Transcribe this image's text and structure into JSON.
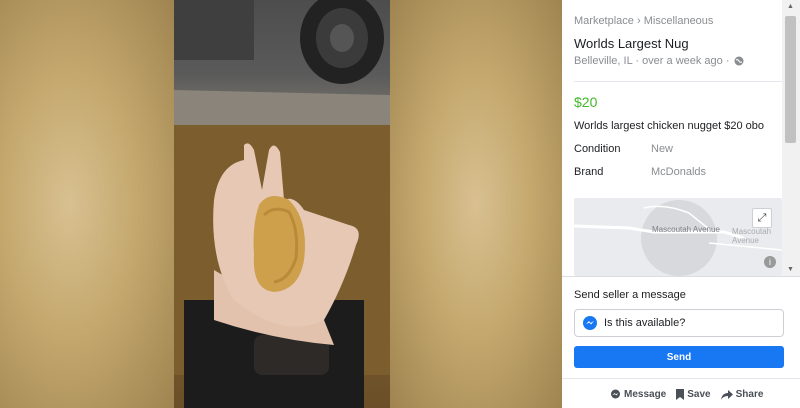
{
  "listing": {
    "breadcrumb_parent": "Marketplace",
    "breadcrumb_sep": "›",
    "breadcrumb_category": "Miscellaneous",
    "title": "Worlds Largest Nug",
    "location_time": "Belleville, IL · over a week ago ·",
    "price": "$20",
    "description": "Worlds largest chicken nugget $20 obo",
    "details": [
      {
        "key": "Condition",
        "value": "New"
      },
      {
        "key": "Brand",
        "value": "McDonalds"
      }
    ],
    "map": {
      "road_label_1": "Mascoutah Avenue",
      "road_label_2": "Mascoutah Avenue"
    }
  },
  "contact": {
    "label": "Send seller a message",
    "message": "Is this available?",
    "send_label": "Send"
  },
  "actions": {
    "message": "Message",
    "save": "Save",
    "share": "Share"
  },
  "colors": {
    "price": "#42b72a",
    "accent": "#1877f2"
  },
  "icons": [
    "chevron-down-icon",
    "globe-icon",
    "expand-icon",
    "info-icon",
    "messenger-icon",
    "message-icon",
    "bookmark-icon",
    "share-icon"
  ]
}
